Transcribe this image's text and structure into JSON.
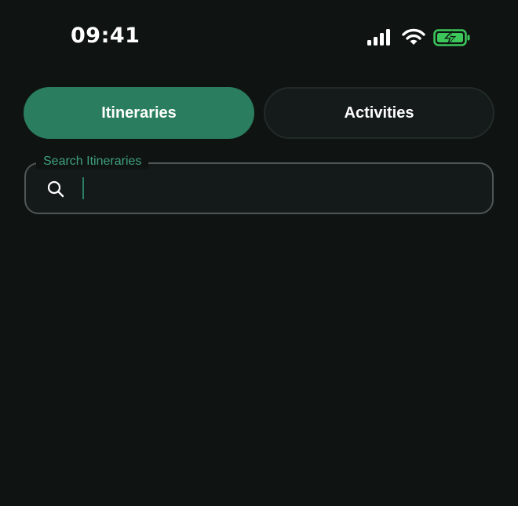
{
  "status_bar": {
    "time": "09:41",
    "icons": [
      "signal-icon",
      "wifi-icon",
      "battery-charging-icon"
    ]
  },
  "tabs": [
    {
      "label": "Itineraries",
      "selected": true
    },
    {
      "label": "Activities",
      "selected": false
    }
  ],
  "search": {
    "label": "Search Itineraries",
    "value": "",
    "placeholder": ""
  },
  "colors": {
    "background": "#0f1413",
    "accent": "#2a7d5f",
    "label_green": "#3fa07d",
    "battery_green": "#3cc75a",
    "inactive_tab": "#151b1a",
    "field_border": "#4f5654"
  }
}
